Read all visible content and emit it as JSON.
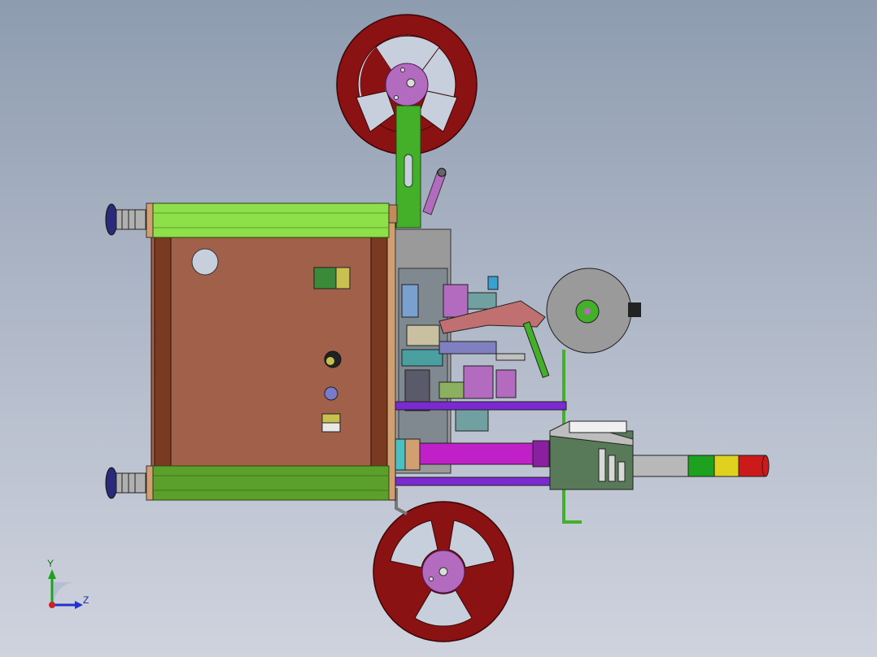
{
  "viewport": {
    "background_top": "#8e9cb0",
    "background_bottom": "#cfd3de"
  },
  "triad": {
    "y_label": "Y",
    "z_label": "Z",
    "y_color": "#1ea11e",
    "z_color": "#2233cc",
    "x_color": "#cc2222"
  },
  "colors": {
    "reel": "#8b1212",
    "hub": "#b36bbf",
    "housing_rail": "#8ee04a",
    "panel": "#a0604a",
    "bracket_green": "#44b02a",
    "tower_gray": "#b8b8b8",
    "tower_green": "#1ea11e",
    "tower_yellow": "#e0d020",
    "tower_red": "#cc1a1a",
    "purple_rod": "#7a2ad0",
    "magenta_cyl": "#c020c8",
    "controller": "#587a58",
    "drum": "#9a9a9a"
  },
  "icons": [
    "reel-icon",
    "light-tower-icon",
    "axis-triad-icon"
  ]
}
